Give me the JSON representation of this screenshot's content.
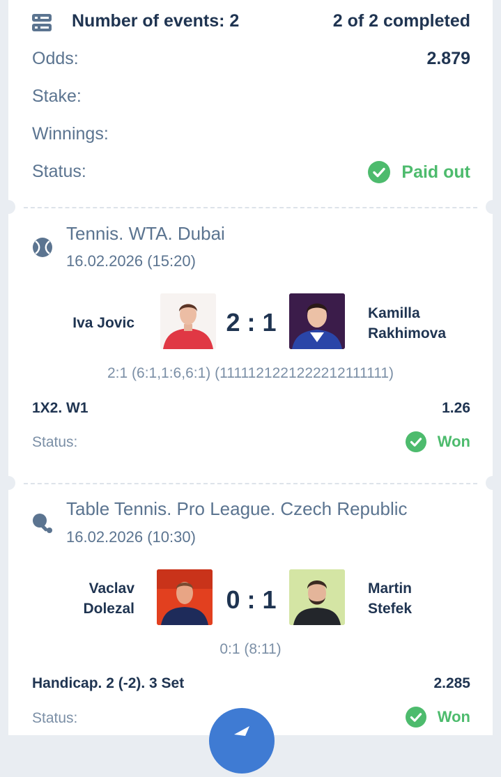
{
  "summary": {
    "events_label": "Number of events: 2",
    "completed": "2 of 2 completed",
    "odds_label": "Odds:",
    "odds_value": "2.879",
    "stake_label": "Stake:",
    "winnings_label": "Winnings:",
    "status_label": "Status:",
    "status_value": "Paid out"
  },
  "events": [
    {
      "title": "Tennis. WTA. Dubai",
      "date": "16.02.2026 (15:20)",
      "icon": "tennis-ball-icon",
      "home": "Iva Jovic",
      "away_line1": "Kamilla",
      "away_line2": "Rakhimova",
      "score": "2 : 1",
      "detail": "2:1 (6:1,1:6,6:1) (1111121221222212111111)",
      "market": "1X2. W1",
      "coef": "1.26",
      "status_label": "Status:",
      "status_value": "Won"
    },
    {
      "title": "Table Tennis. Pro League. Czech Republic",
      "date": "16.02.2026 (10:30)",
      "icon": "table-tennis-icon",
      "home_line1": "Vaclav",
      "home_line2": "Dolezal",
      "away_line1": "Martin",
      "away_line2": "Stefek",
      "score": "0 : 1",
      "detail": "0:1 (8:11)",
      "market": "Handicap. 2 (-2). 3 Set",
      "coef": "2.285",
      "status_label": "Status:",
      "status_value": "Won"
    }
  ],
  "colors": {
    "text_dark": "#1f3451",
    "text_muted": "#5b7490",
    "success": "#4dbb6d",
    "accent": "#3f7bd3"
  }
}
